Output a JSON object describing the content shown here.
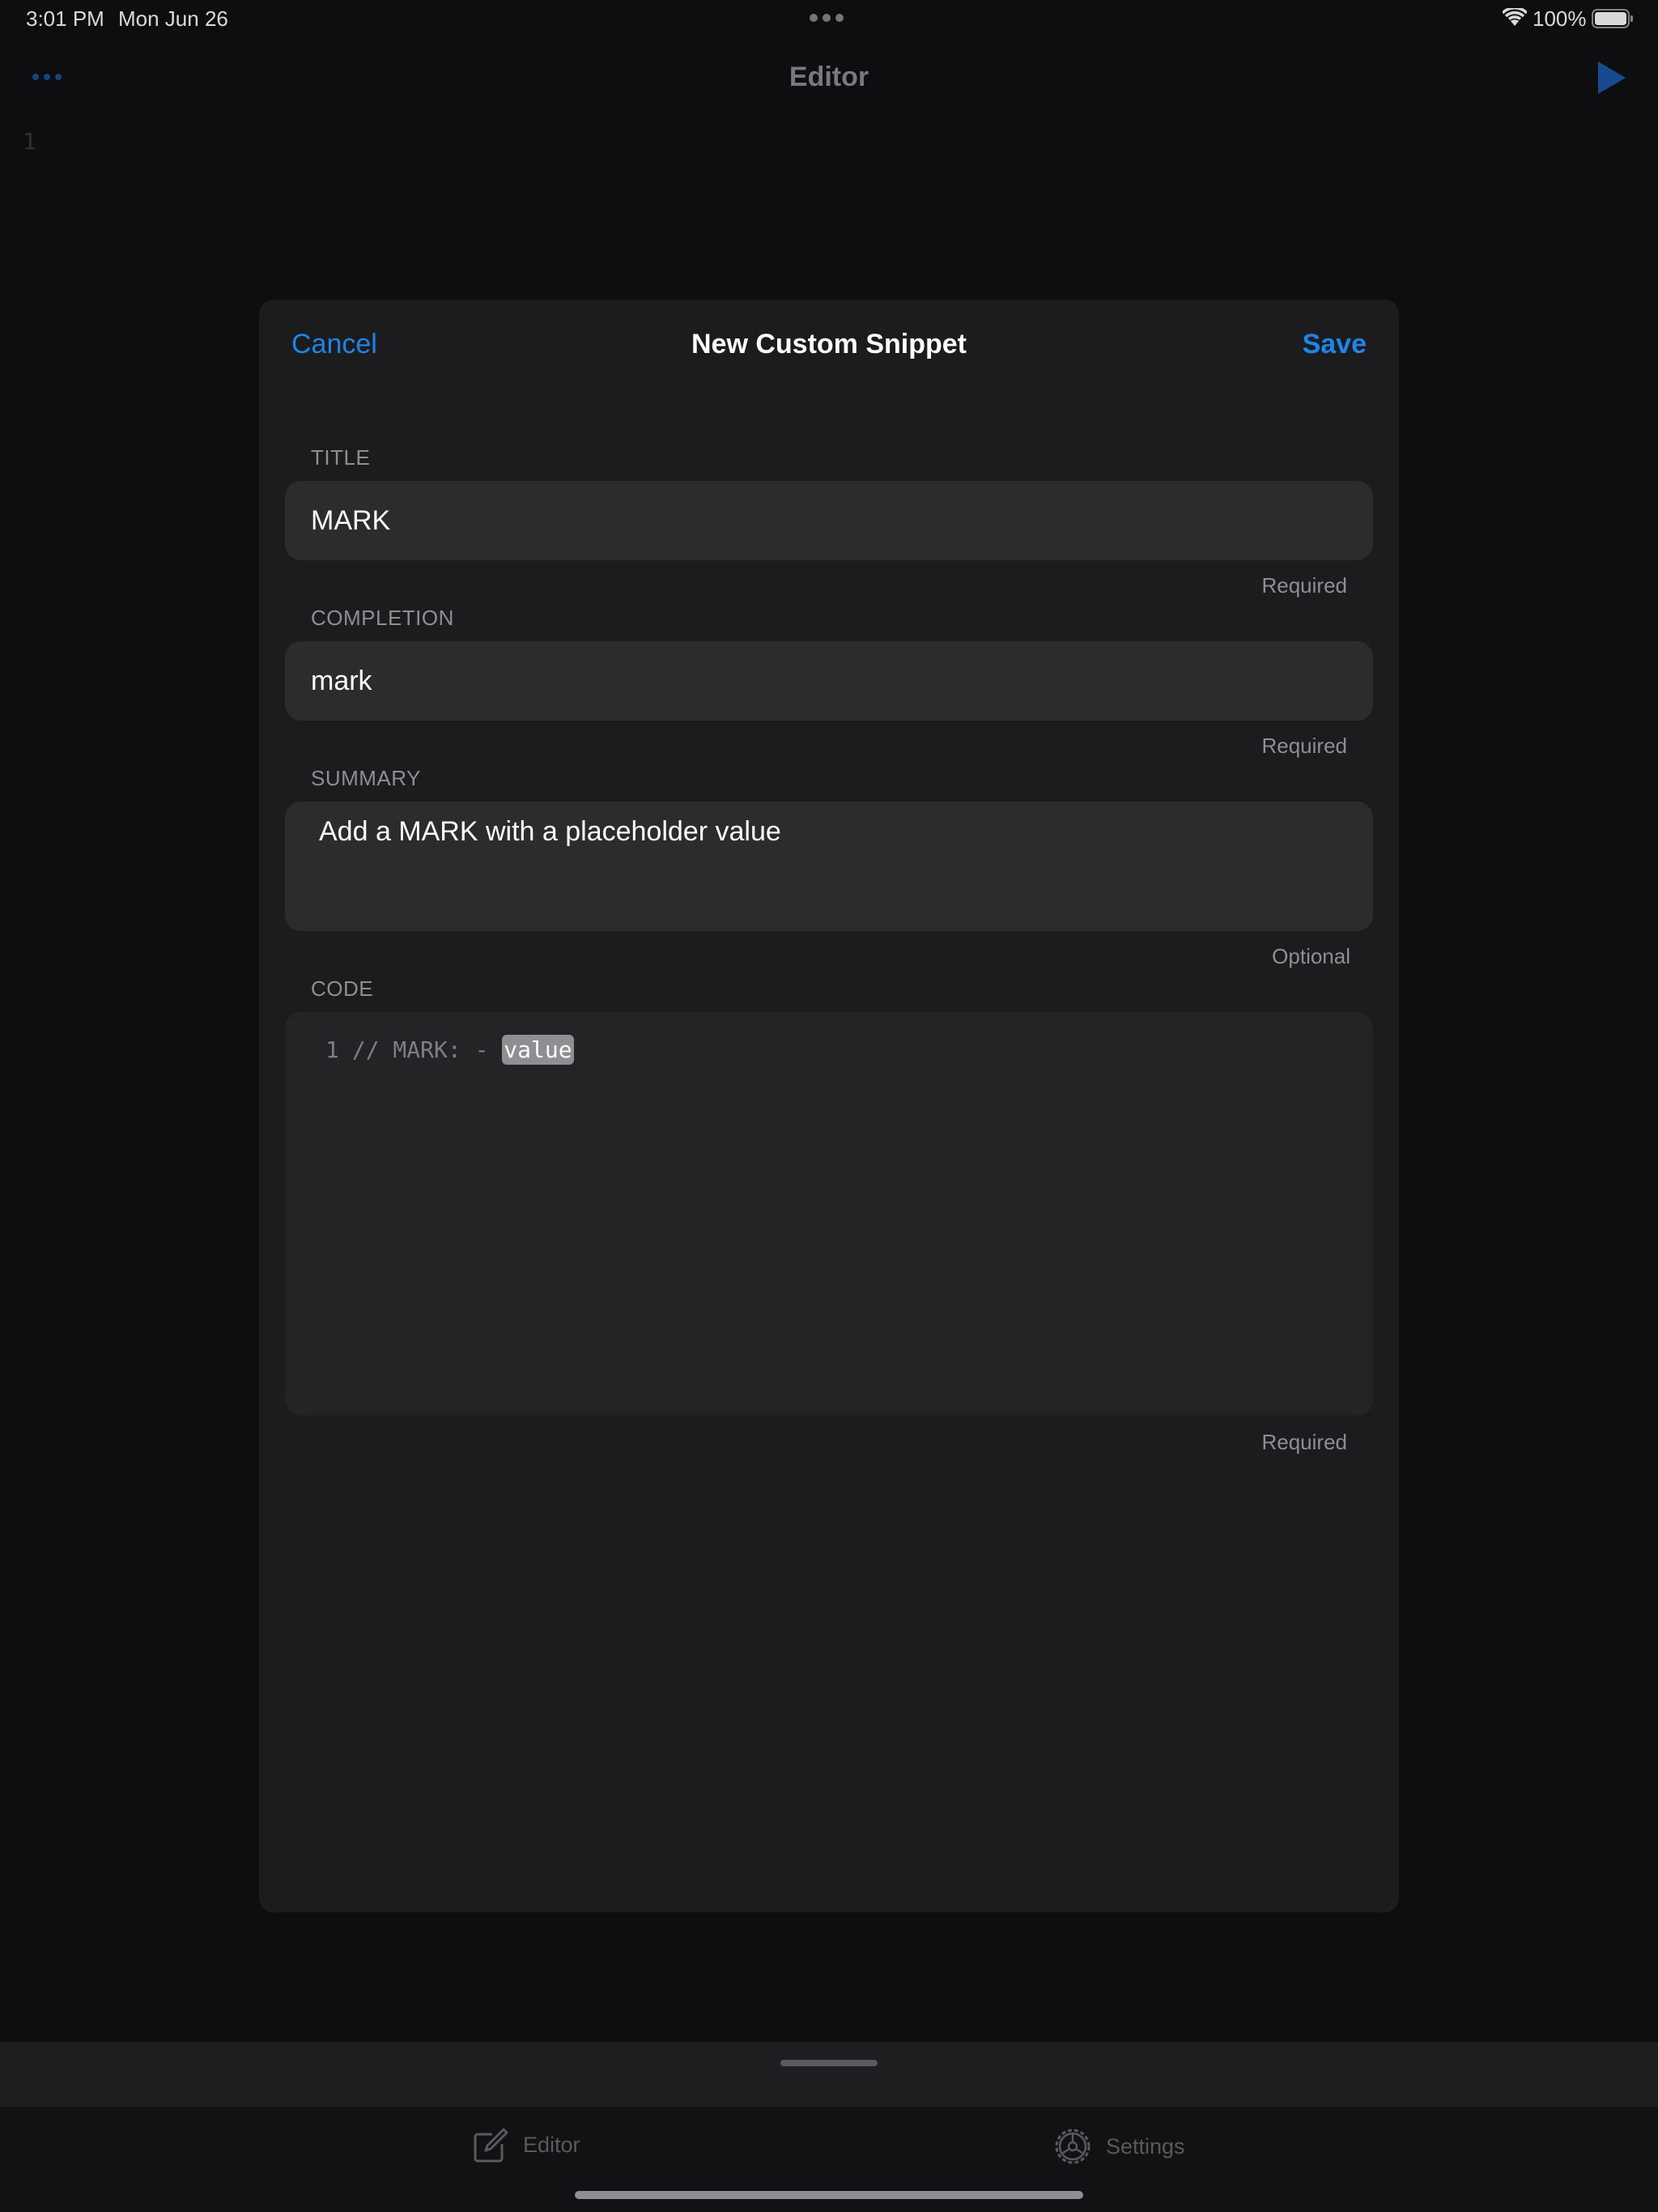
{
  "status_bar": {
    "time": "3:01 PM",
    "date": "Mon Jun 26",
    "battery": "100%"
  },
  "nav": {
    "title": "Editor"
  },
  "editor": {
    "line_number": "1"
  },
  "modal": {
    "cancel_label": "Cancel",
    "title": "New Custom Snippet",
    "save_label": "Save",
    "title_field": {
      "label": "TITLE",
      "value": "MARK",
      "hint": "Required"
    },
    "completion_field": {
      "label": "COMPLETION",
      "value": "mark",
      "hint": "Required"
    },
    "summary_field": {
      "label": "SUMMARY",
      "value": "Add a MARK with a placeholder value",
      "hint": "Optional"
    },
    "code_field": {
      "label": "CODE",
      "line_number": "1",
      "code_prefix": "// MARK: - ",
      "placeholder": "value",
      "hint": "Required"
    }
  },
  "tabs": [
    {
      "label": "Editor",
      "icon": "compose-icon"
    },
    {
      "label": "Settings",
      "icon": "gear-icon"
    }
  ],
  "colors": {
    "accent": "#1d85e8",
    "background": "#111113",
    "modal": "#1c1c1e",
    "field": "#2c2c2e"
  }
}
